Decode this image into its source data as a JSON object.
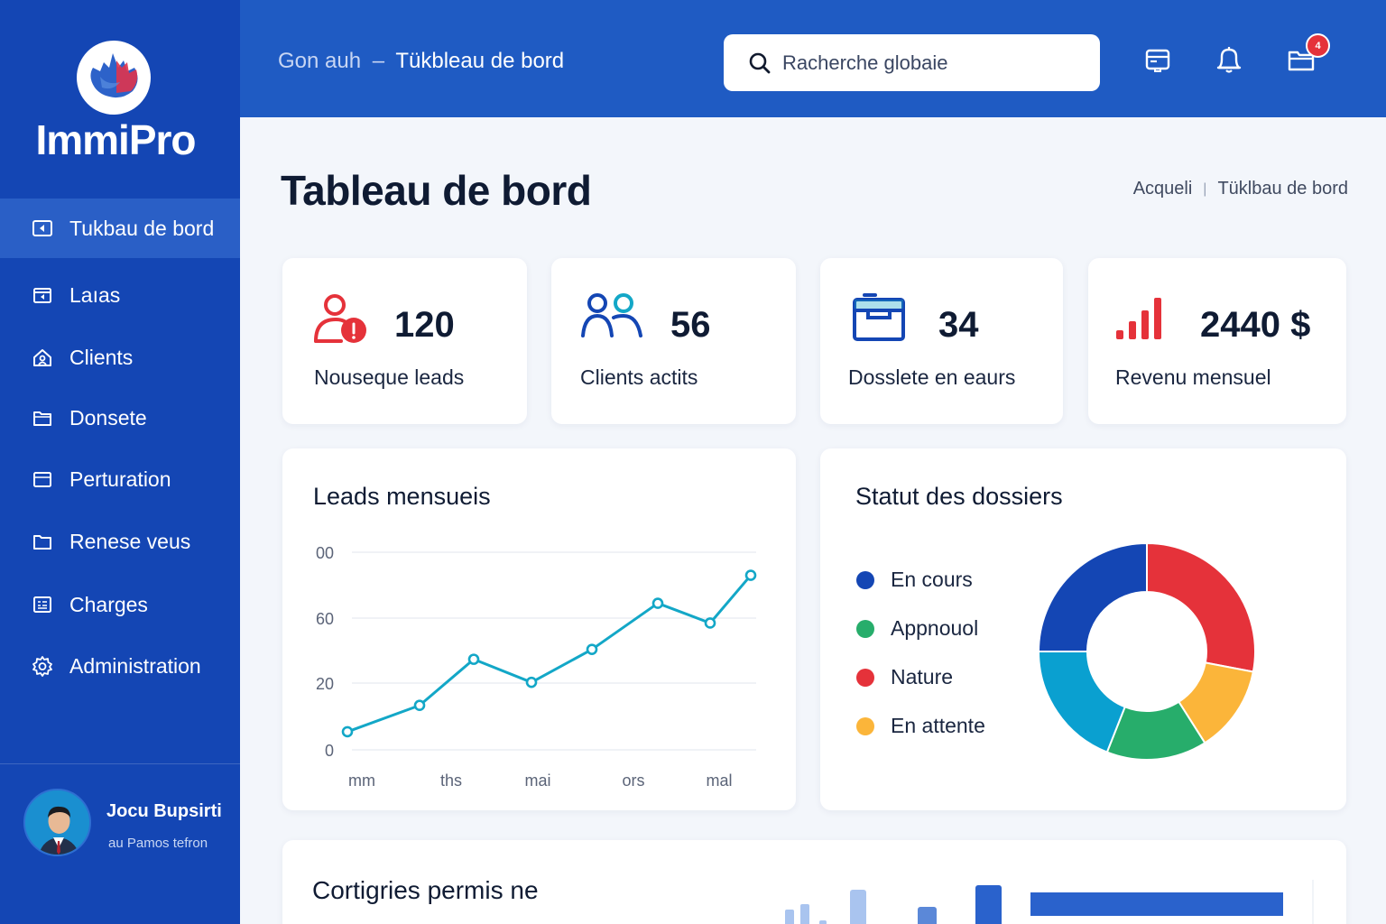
{
  "app": {
    "name": "ImmiPro"
  },
  "sidebar": {
    "items": [
      {
        "label": "Tukbau de bord",
        "icon": "dashboard-icon",
        "active": true
      },
      {
        "label": "Laıas",
        "icon": "leads-icon"
      },
      {
        "label": "Clients",
        "icon": "clients-icon"
      },
      {
        "label": "Donsete",
        "icon": "folder-icon"
      },
      {
        "label": "Perturation",
        "icon": "folder-icon"
      },
      {
        "label": "Renese veus",
        "icon": "folder-icon"
      },
      {
        "label": "Charges",
        "icon": "charges-icon"
      },
      {
        "label": "Administration",
        "icon": "gear-icon"
      }
    ]
  },
  "profile": {
    "name": "Jocu Bupsirti",
    "subtitle": "au Pamos tefron"
  },
  "header": {
    "crumb_muted": "Gon auh",
    "crumb_sep": "–",
    "crumb_current": "Tükbleau de bord",
    "search_placeholder": "Racherche globaie",
    "notification_badge": "4"
  },
  "page": {
    "title": "Tableau de bord",
    "breadcrumb": [
      "Acqueli",
      "Tüklbau de bord"
    ]
  },
  "stats": [
    {
      "value": "120",
      "label": "Nouseque leads",
      "icon": "new-lead-icon"
    },
    {
      "value": "56",
      "label": "Clients actits",
      "icon": "users-icon"
    },
    {
      "value": "34",
      "label": "Dosslete en eaurs",
      "icon": "folder-open-icon"
    },
    {
      "value": "2440 $",
      "label": "Revenu mensuel",
      "icon": "bar-chart-icon"
    }
  ],
  "leads_chart": {
    "title": "Leads mensueis"
  },
  "status_chart": {
    "title": "Statut des dossiers"
  },
  "bottom_card": {
    "title": "Cortigries permis ne"
  },
  "colors": {
    "sidebar": "#1446b4",
    "header": "#1f5bc3",
    "accent_cyan": "#13a7c7",
    "red": "#e5323a",
    "blue": "#1446b4",
    "green": "#27ad6b",
    "orange": "#fbb53a"
  },
  "chart_data": [
    {
      "type": "line",
      "title": "Leads mensueis",
      "xlabel": "",
      "ylabel": "",
      "x_tick_labels": [
        "mm",
        "ths",
        "mai",
        "ors",
        "mal"
      ],
      "y_tick_labels": [
        "0",
        "20",
        "60",
        "00"
      ],
      "ylim": [
        0,
        6
      ],
      "grid": true,
      "series": [
        {
          "color": "#13a7c7",
          "values": [
            0.55,
            1.35,
            2.75,
            2.05,
            3.05,
            4.45,
            3.85,
            5.3
          ]
        }
      ]
    },
    {
      "type": "pie",
      "title": "Statut des dossiers",
      "legend_position": "left",
      "donut": true,
      "slices": [
        {
          "label": "En cours",
          "value": 25,
          "color": "#1446b4"
        },
        {
          "label": "Nature",
          "value": 28,
          "color": "#e5323a"
        },
        {
          "label": "En attente",
          "value": 13,
          "color": "#fbb53a"
        },
        {
          "label": "Appnouol",
          "value": 15,
          "color": "#27ad6b"
        },
        {
          "label": "",
          "value": 19,
          "color": "#0aa0d0"
        }
      ],
      "legend": [
        {
          "label": "En cours",
          "color": "#1446b4"
        },
        {
          "label": "Appnouol",
          "color": "#27ad6b"
        },
        {
          "label": "Nature",
          "color": "#e5323a"
        },
        {
          "label": "En attente",
          "color": "#fbb53a"
        }
      ]
    }
  ]
}
